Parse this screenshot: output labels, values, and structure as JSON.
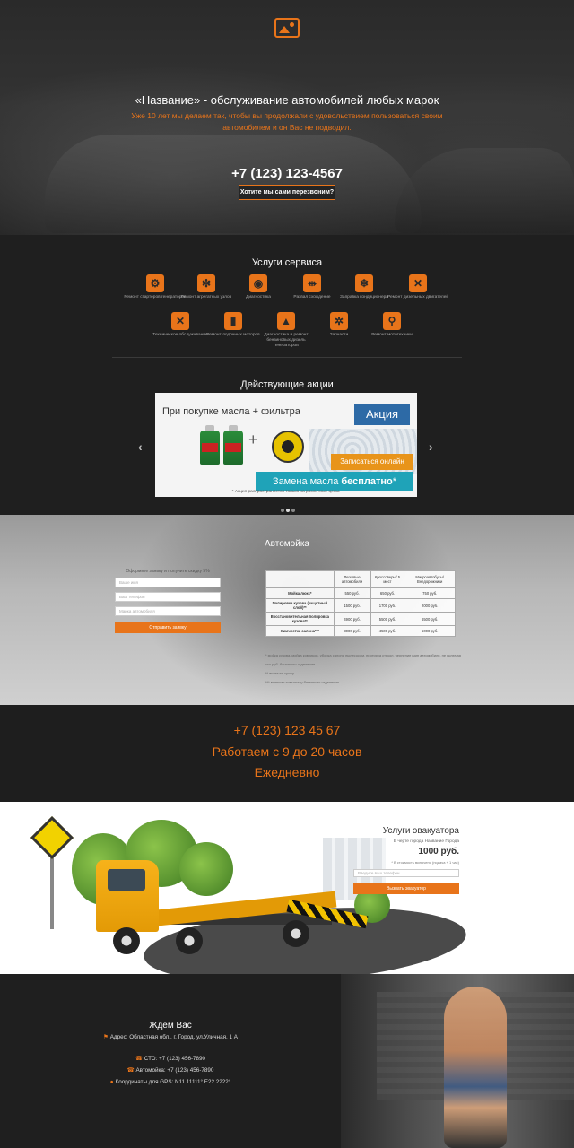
{
  "hero": {
    "title": "«Название» - обслуживание автомобилей любых марок",
    "subtitle": "Уже 10 лет мы делаем так, чтобы вы продолжали с удовольствием пользоваться своим автомобилем и он Вас не подводил.",
    "phone": "+7 (123) 123-4567",
    "callback_label": "Хотите мы сами перезвоним?"
  },
  "services": {
    "title": "Услуги сервиса",
    "items": [
      {
        "label": "Ремонт стартеров генераторов",
        "icon": "starter-icon"
      },
      {
        "label": "Ремонт агрегатных узлов",
        "icon": "gear-icon"
      },
      {
        "label": "Диагностика",
        "icon": "diagnostics-icon"
      },
      {
        "label": "Развал схождение",
        "icon": "alignment-icon"
      },
      {
        "label": "Заправка кондиционера",
        "icon": "ac-icon"
      },
      {
        "label": "Ремонт дизельных двигателей",
        "icon": "tools-icon"
      },
      {
        "label": "Техническое обслуживание",
        "icon": "wrench-icon"
      },
      {
        "label": "Ремонт лодочных моторов",
        "icon": "boat-motor-icon"
      },
      {
        "label": "Диагностика и ремонт бензиновых дизель генераторов",
        "icon": "generator-icon"
      },
      {
        "label": "Запчасти",
        "icon": "parts-icon"
      },
      {
        "label": "Ремонт мототехники",
        "icon": "motorbike-icon"
      }
    ]
  },
  "promo": {
    "title": "Действующие акции",
    "top_text": "При покупке масла  +  фильтра",
    "badge": "Акция",
    "signup_label": "Записаться онлайн",
    "free_text_a": "Замена масла ",
    "free_text_b": "бесплатно",
    "free_mark": "*",
    "note": "* Акция распространяется только на розничные цены."
  },
  "wash": {
    "title": "Автомойка",
    "form_label": "Оформите заявку и получите скидку 5%",
    "inputs": [
      "Ваше имя",
      "Ваш телефон",
      "Марка автомобиля"
    ],
    "submit_label": "Отправить заявку",
    "table": {
      "headers": [
        "",
        "Легковые автомобили",
        "Кроссоверы/ 5 мест",
        "Микроавтобусы/ Внедорожники"
      ],
      "rows": [
        {
          "label": "Мойка люкс*",
          "values": [
            "550 руб.",
            "650 руб.",
            "750 руб."
          ]
        },
        {
          "label": "Полировка кузова (защитный слой)**",
          "values": [
            "1500 руб.",
            "1700 руб.",
            "2000 руб."
          ]
        },
        {
          "label": "Восстановительная полировка кузова**",
          "values": [
            "4900 руб.",
            "5500 руб.",
            "6500 руб."
          ]
        },
        {
          "label": "Химчистка салона***",
          "values": [
            "3000 руб.",
            "4500 руб.",
            "5000 руб."
          ]
        }
      ]
    },
    "notes": [
      "* мойка кузова, мойка ковриков, уборка салона пылесосом, протирка стекол, чернение шин автомобиля, не включая сто руб. багажного отделения",
      "** включая сушку",
      "*** включая химчистку багажного отделения"
    ]
  },
  "contacts": {
    "phone": "+7 (123) 123 45 67",
    "hours": "Работаем с 9 до 20 часов",
    "days": "Ежедневно"
  },
  "tow": {
    "title": "Услуги эвакуатора",
    "city_label": "В черте города Название Города",
    "price": "1000 руб.",
    "note": "* В стоимость включено (подача + 1 час)",
    "input_placeholder": "Введите ваш телефон",
    "button_label": "Вызвать эвакуатор"
  },
  "footer": {
    "title": "Ждем Вас",
    "address": "Адрес: Областная обл., г. Город, ул.Уличная, 1 А",
    "sto_phone": "СТО: +7 (123) 456-7890",
    "wash_phone": "Автомойка: +7 (123) 456-7890",
    "gps": "Координаты для GPS: N11.11111° E22.2222°"
  },
  "colors": {
    "accent": "#e8741a",
    "dark": "#1f1f1f",
    "promo_blue": "#2d6aa6",
    "promo_teal": "#1fa3b8"
  }
}
